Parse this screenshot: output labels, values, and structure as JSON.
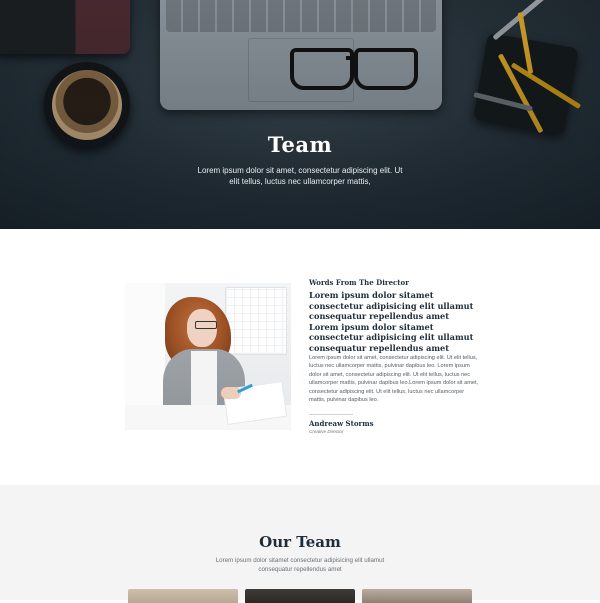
{
  "hero": {
    "title": "Team",
    "subtitle": "Lorem ipsum dolor sit amet, consectetur adipiscing elit. Ut elit tellus, luctus nec ullamcorper mattis,"
  },
  "director": {
    "eyebrow": "Words From The Director",
    "quote": "Lorem ipsum dolor sitamet consectetur adipisicing elit ullamut consequatur repellendus amet  Lorem ipsum dolor sitamet consectetur adipisicing elit ullamut consequatur repellendus amet",
    "body": "Lorem ipsum dolor sit amet, consectetur adipiscing elit. Ut elit tellus, luctus nec ullamcorper mattis, pulvinar dapibus leo. Lorem ipsum dolor sit amet, consectetur adipiscing elit. Ut elit tellus, luctus nec ullamcorper mattis, pulvinar dapibus leo.Lorem ipsum dolor sit amet, consectetur adipiscing elit. Ut elit tellus, luctus nec ullamcorper mattis, pulvinar dapibus leo.",
    "name": "Andreaw Storms",
    "role": "Creative Director"
  },
  "team": {
    "title": "Our Team",
    "subtitle": "Lorem ipsum dolor sitamet consectetur adipisicing elit ullamut consequatur repellendus amet"
  }
}
